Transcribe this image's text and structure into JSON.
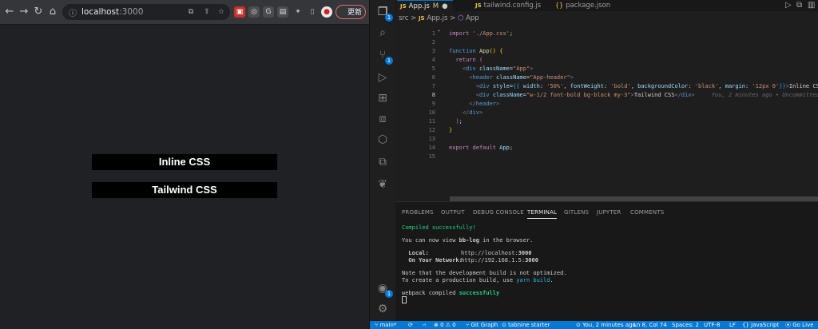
{
  "browser": {
    "url_host": "localhost",
    "url_port": ":3000",
    "update_label": "更新",
    "boxes": {
      "inline": "Inline CSS",
      "tailwind": "Tailwind CSS"
    }
  },
  "editor": {
    "tabs": [
      {
        "name": "App.js",
        "badge": "M"
      },
      {
        "name": "tailwind.config.js"
      },
      {
        "name": "package.json"
      }
    ],
    "breadcrumb": {
      "folder": "src",
      "sep": ">",
      "file": "App.js",
      "symbol": "App"
    },
    "line_numbers": [
      "1",
      "2",
      "3",
      "4",
      "5",
      "6",
      "7",
      "8",
      "9",
      "10",
      "11",
      "12",
      "13",
      "14",
      "15"
    ],
    "blame": "You, 2 minutes ago • Uncommitted changes"
  },
  "panel": {
    "tabs": [
      "PROBLEMS",
      "OUTPUT",
      "DEBUG CONSOLE",
      "TERMINAL",
      "GITLENS",
      "JUPYTER",
      "COMMENTS"
    ],
    "active_tab": "TERMINAL",
    "terminal": {
      "compiled": "Compiled successfully!",
      "view_pre": "You can now view ",
      "app_name": "bb-log",
      "view_post": " in the browser.",
      "local_label": "  Local:",
      "local_host": "http://localhost:",
      "local_port": "3000",
      "network_label": "  On Your Network:",
      "network_host": "http://192.168.1.5:",
      "network_port": "3000",
      "note1": "Note that the development build is not optimized.",
      "note2_pre": "To create a production build, use ",
      "note2_cmd": "yarn build",
      "note2_post": ".",
      "webpack_pre": "webpack compiled ",
      "webpack_status": "successfully"
    }
  },
  "statusbar": {
    "branch": "main*",
    "git_graph": "Git Graph",
    "tabnine": "tabnine starter",
    "errors": "0",
    "warnings": "0",
    "blame": "You, 2 minutes ago",
    "position": "Ln 8, Col 74",
    "spaces": "Spaces: 2",
    "encoding": "UTF-8",
    "eol": "LF",
    "language": "JavaScript",
    "golive": "Go Live"
  },
  "colors": {
    "accent": "#0078d4",
    "terminal_green": "#23d18b"
  }
}
